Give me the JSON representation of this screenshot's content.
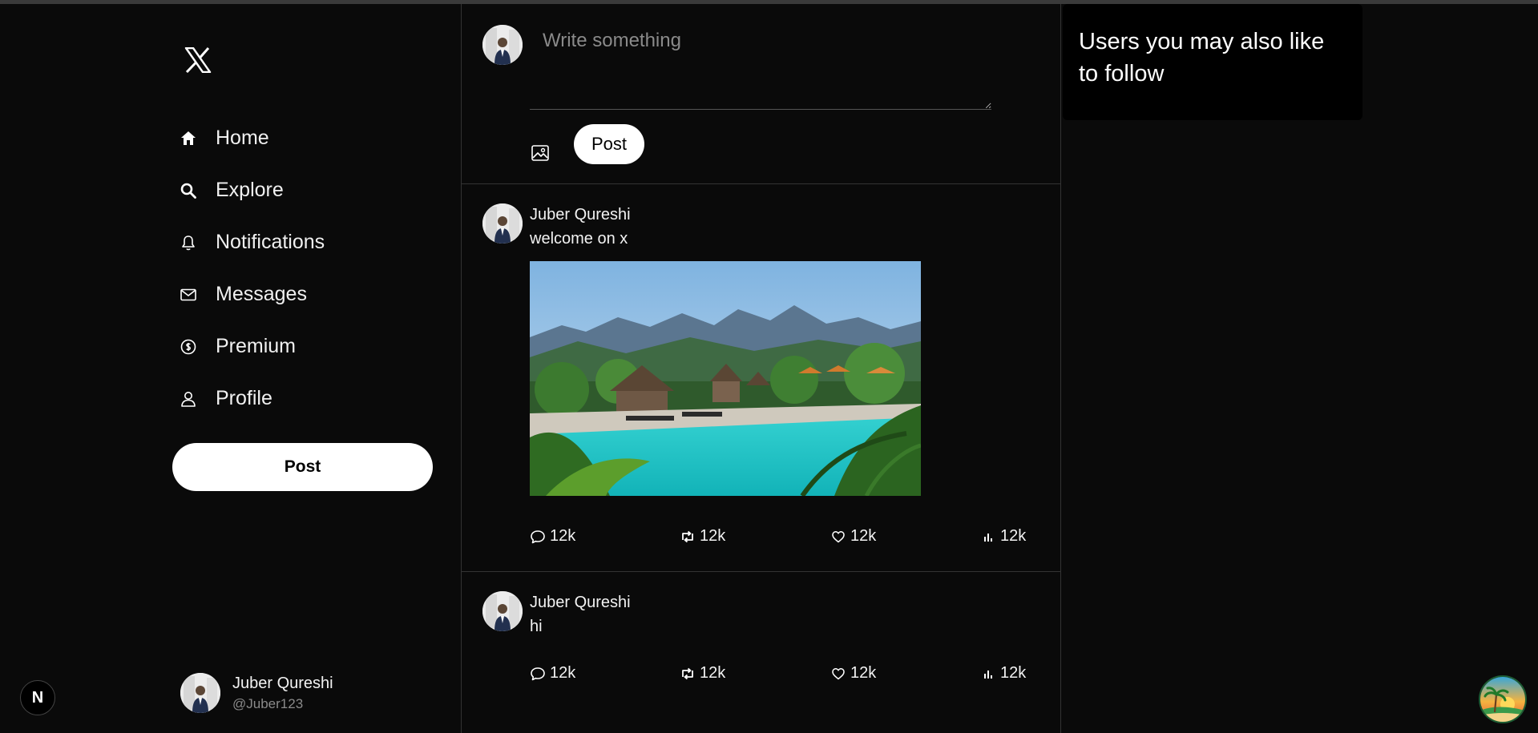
{
  "nav": {
    "items": [
      {
        "label": "Home",
        "icon": "home-icon"
      },
      {
        "label": "Explore",
        "icon": "search-icon"
      },
      {
        "label": "Notifications",
        "icon": "bell-icon"
      },
      {
        "label": "Messages",
        "icon": "envelope-icon"
      },
      {
        "label": "Premium",
        "icon": "premium-icon"
      },
      {
        "label": "Profile",
        "icon": "person-icon"
      }
    ],
    "post_label": "Post"
  },
  "current_user": {
    "name": "Juber Qureshi",
    "handle": "@Juber123"
  },
  "composer": {
    "placeholder": "Write something",
    "post_label": "Post"
  },
  "tweets": [
    {
      "author": "Juber Qureshi",
      "text": "welcome on x",
      "has_image": true,
      "replies": "12k",
      "reposts": "12k",
      "likes": "12k",
      "views": "12k"
    },
    {
      "author": "Juber Qureshi",
      "text": "hi",
      "has_image": false,
      "replies": "12k",
      "reposts": "12k",
      "likes": "12k",
      "views": "12k"
    }
  ],
  "sidebar_right": {
    "title": "Users you may also like to follow"
  },
  "badges": {
    "next_letter": "N"
  },
  "colors": {
    "background": "#0a0a0a",
    "panel": "#000000",
    "divider": "#333333",
    "primary_button": "#ffffff",
    "muted_text": "#8a8a8a"
  }
}
